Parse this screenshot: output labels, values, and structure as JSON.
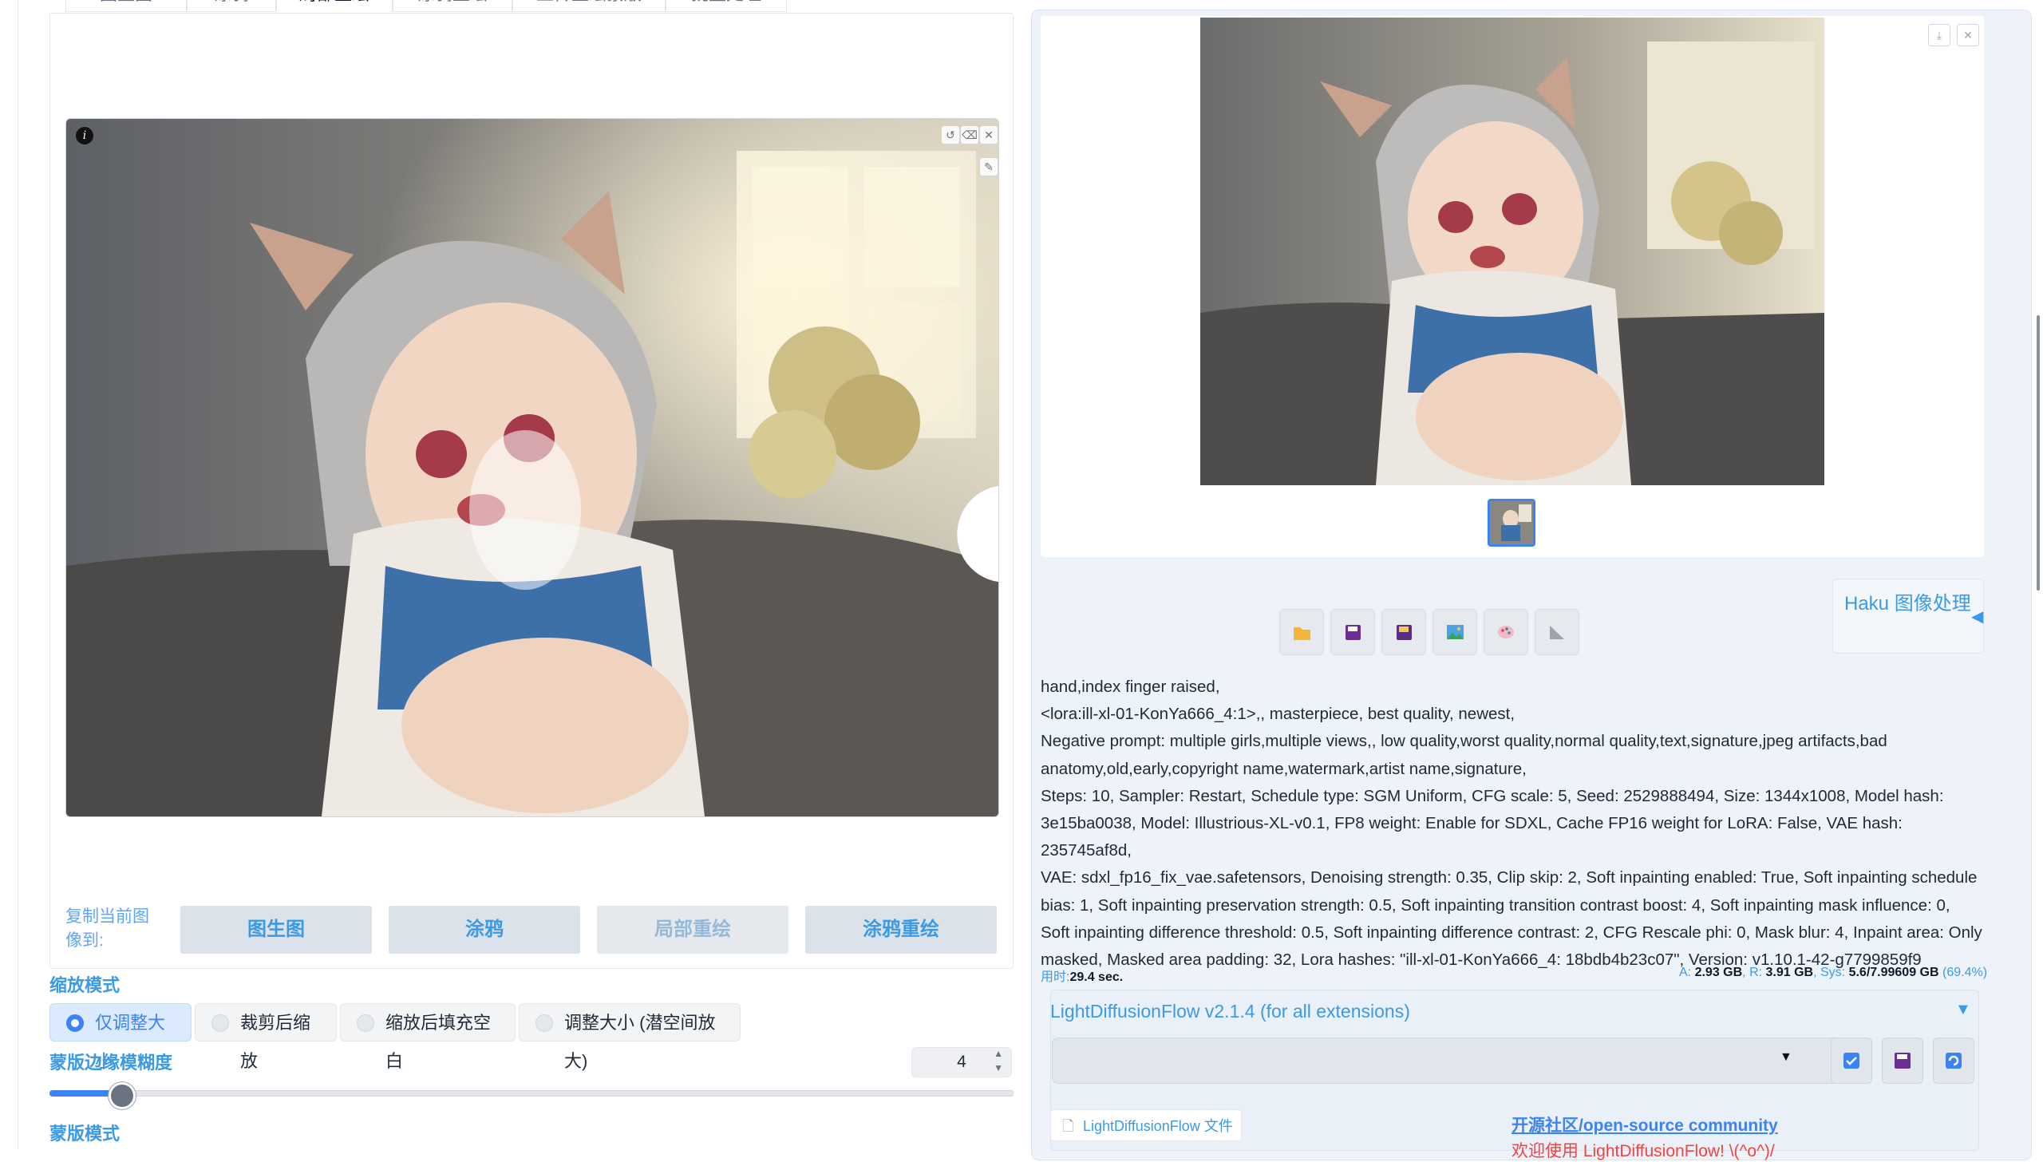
{
  "tabs": [
    "图生图",
    "涂鸦",
    "局部重绘",
    "涂鸦重绘",
    "上传重绘蒙版",
    "批量处理"
  ],
  "active_tab_index": 2,
  "editor": {
    "info_icon": "i",
    "undo_icon": "undo-icon",
    "clear_icon": "eraser-icon",
    "close_icon": "close-icon",
    "brush_icon": "brush-icon"
  },
  "copy_to": {
    "label": "复制当前图像到:",
    "buttons": [
      "图生图",
      "涂鸦",
      "局部重绘",
      "涂鸦重绘"
    ]
  },
  "resize_mode": {
    "label": "缩放模式",
    "options": [
      "仅调整大小",
      "裁剪后缩放",
      "缩放后填充空白",
      "调整大小 (潜空间放大)"
    ],
    "selected": 0
  },
  "mask_blur": {
    "label": "蒙版边缘模糊度",
    "value": "4",
    "fraction": 0.044
  },
  "mask_mode": {
    "label": "蒙版模式"
  },
  "output": {
    "toolbar_icons": [
      "folder-icon",
      "save-icon",
      "zip-icon",
      "image-icon",
      "palette-icon",
      "ruler-icon"
    ],
    "haku_label": "Haku 图像处理",
    "info_lines": [
      "hand,index finger raised,",
      "<lora:ill-xl-01-KonYa666_4:1>,, masterpiece, best quality, newest,",
      "Negative prompt: multiple girls,multiple views,, low quality,worst quality,normal quality,text,signature,jpeg artifacts,bad",
      "anatomy,old,early,copyright name,watermark,artist name,signature,",
      "Steps: 10, Sampler: Restart, Schedule type: SGM Uniform, CFG scale: 5, Seed: 2529888494, Size: 1344x1008, Model hash:",
      "3e15ba0038, Model: Illustrious-XL-v0.1, FP8 weight: Enable for SDXL, Cache FP16 weight for LoRA: False, VAE hash: 235745af8d,",
      "VAE: sdxl_fp16_fix_vae.safetensors, Denoising strength: 0.35, Clip skip: 2, Soft inpainting enabled: True, Soft inpainting schedule",
      "bias: 1, Soft inpainting preservation strength: 0.5, Soft inpainting transition contrast boost: 4, Soft inpainting mask influence: 0,",
      "Soft inpainting difference threshold: 0.5, Soft inpainting difference contrast: 2, CFG Rescale phi: 0, Mask blur: 4, Inpaint area: Only",
      "masked, Masked area padding: 32, Lora hashes: \"ill-xl-01-KonYa666_4: 18bdb4b23c07\", Version: v1.10.1-42-g7799859f9"
    ],
    "time_label": "用时:",
    "time_value": "29.4 sec.",
    "mem_a_label": "A:",
    "mem_a_value": "2.93 GB",
    "mem_r_label": "R:",
    "mem_r_value": "3.91 GB",
    "mem_sys_label": "Sys:",
    "mem_sys_value": "5.6/7.99609 GB",
    "mem_sys_pct": "(69.4%)"
  },
  "ldf": {
    "title": "LightDiffusionFlow v2.1.4 (for all extensions)",
    "file_button": "LightDiffusionFlow 文件",
    "community_link": "开源社区/open-source community",
    "welcome": "欢迎使用 LightDiffusionFlow! \\(^o^)/"
  },
  "colors": {
    "accent": "#3b9ae6",
    "selected_radio": "#3b82f6",
    "panel_bg": "#eef3f9"
  }
}
